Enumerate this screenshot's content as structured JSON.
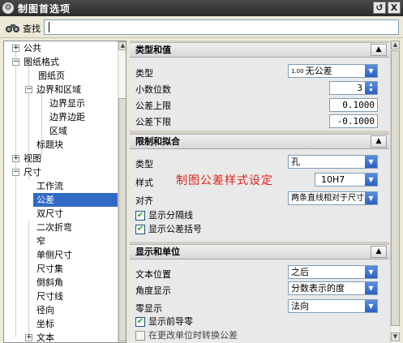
{
  "window": {
    "title": "制图首选项",
    "icon": "gear-icon",
    "buttons": [
      {
        "icon": "reset-icon",
        "glyph": "↺"
      },
      {
        "icon": "close-icon",
        "glyph": "X"
      }
    ]
  },
  "search": {
    "label": "查找",
    "value": ""
  },
  "tree": {
    "items": [
      {
        "label": "公共",
        "expander": "+",
        "selected": false
      },
      {
        "label": "图纸格式",
        "expander": "−",
        "selected": false
      },
      {
        "label": "图纸页",
        "expander": "",
        "selected": false
      },
      {
        "label": "边界和区域",
        "expander": "−",
        "selected": false
      },
      {
        "label": "边界显示",
        "expander": "",
        "selected": false
      },
      {
        "label": "边界边距",
        "expander": "",
        "selected": false
      },
      {
        "label": "区域",
        "expander": "",
        "selected": false
      },
      {
        "label": "标题块",
        "expander": "",
        "selected": false
      },
      {
        "label": "视图",
        "expander": "+",
        "selected": false
      },
      {
        "label": "尺寸",
        "expander": "−",
        "selected": false
      },
      {
        "label": "工作流",
        "expander": "",
        "selected": false
      },
      {
        "label": "公差",
        "expander": "",
        "selected": true
      },
      {
        "label": "双尺寸",
        "expander": "",
        "selected": false
      },
      {
        "label": "二次折弯",
        "expander": "",
        "selected": false
      },
      {
        "label": "窄",
        "expander": "",
        "selected": false
      },
      {
        "label": "单侧尺寸",
        "expander": "",
        "selected": false
      },
      {
        "label": "尺寸集",
        "expander": "",
        "selected": false
      },
      {
        "label": "倒斜角",
        "expander": "",
        "selected": false
      },
      {
        "label": "尺寸线",
        "expander": "",
        "selected": false
      },
      {
        "label": "径向",
        "expander": "",
        "selected": false
      },
      {
        "label": "坐标",
        "expander": "",
        "selected": false
      },
      {
        "label": "文本",
        "expander": "+",
        "selected": false
      }
    ]
  },
  "sections": {
    "type_value": {
      "title": "类型和值",
      "type_label": "类型",
      "type_badge": "1.00",
      "type_value": "无公差",
      "decimals_label": "小数位数",
      "decimals_value": "3",
      "upper_label": "公差上限",
      "upper_value": "0.1000",
      "lower_label": "公差下限",
      "lower_value": "-0.1000"
    },
    "limits_fits": {
      "title": "限制和拟合",
      "type_label": "类型",
      "type_value": "孔",
      "style_label": "样式",
      "style_value": "10H7",
      "align_label": "对齐",
      "align_value": "两条直线相对于尺寸",
      "show_separator": "显示分隔线",
      "show_brackets": "显示公差括号"
    },
    "display_units": {
      "title": "显示和单位",
      "text_pos_label": "文本位置",
      "text_pos_value": "之后",
      "angle_label": "角度显示",
      "angle_value": "分数表示的度",
      "zero_label": "零显示",
      "zero_value": "法向",
      "show_leading_zero": "显示前导零",
      "convert_on_unit_change": "在更改单位时转换公差"
    }
  },
  "annotation": "制图公差样式设定",
  "colors": {
    "selection": "#316ac5",
    "annotation": "#e0201a",
    "titlebar": "#2a2a2a"
  }
}
